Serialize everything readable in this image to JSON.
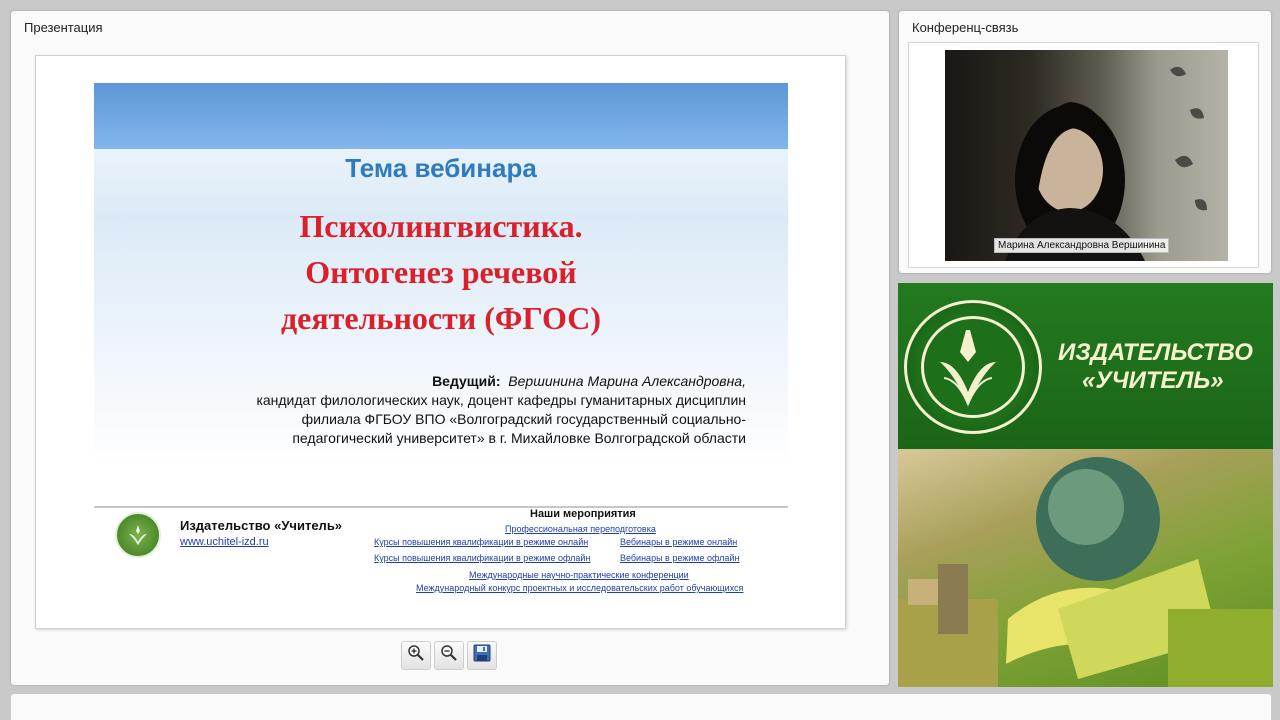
{
  "presentation": {
    "title": "Презентация",
    "slide": {
      "subtitle": "Тема вебинара",
      "heading_lines": [
        "Психолингвистика.",
        "Онтогенез речевой",
        "деятельности (ФГОС)"
      ],
      "presenter_label": "Ведущий:",
      "presenter_name": "Вершинина Марина Александровна,",
      "presenter_lines": [
        "кандидат филологических наук, доцент кафедры гуманитарных дисциплин",
        "филиала ФГБОУ ВПО «Волгоградский государственный социально-",
        "педагогический университет» в г. Михайловке Волгоградской области"
      ],
      "publisher_name": "Издательство «Учитель»",
      "publisher_url": "www.uchitel-izd.ru",
      "events_title": "Наши мероприятия",
      "events": {
        "retraining": "Профессиональная переподготовка",
        "courses_online": "Курсы повышения квалификации в режиме онлайн",
        "webinars_online": "Вебинары в режиме онлайн",
        "courses_offline": "Курсы повышения квалификации в режиме офлайн",
        "webinars_offline": "Вебинары в режиме офлайн",
        "conferences": "Международные научно-практические конференции",
        "contest": "Международный конкурс проектных и исследовательских работ обучающихся"
      }
    },
    "toolbar": {
      "zoom_in_icon": "zoom-in-icon",
      "zoom_out_icon": "zoom-out-icon",
      "save_icon": "floppy-disk-icon"
    }
  },
  "conference": {
    "title": "Конференц-связь",
    "participant_name": "Марина Александровна Вершинина"
  },
  "publisher_banner": {
    "line1": "ИЗДАТЕЛЬСТВО",
    "line2": "«УЧИТЕЛЬ»"
  },
  "colors": {
    "slide_heading": "#d9202b",
    "slide_subtitle": "#2e7bbf",
    "banner_green": "#1f6d1c",
    "banner_text": "#f6f2cd",
    "link": "#1f3fa6"
  }
}
